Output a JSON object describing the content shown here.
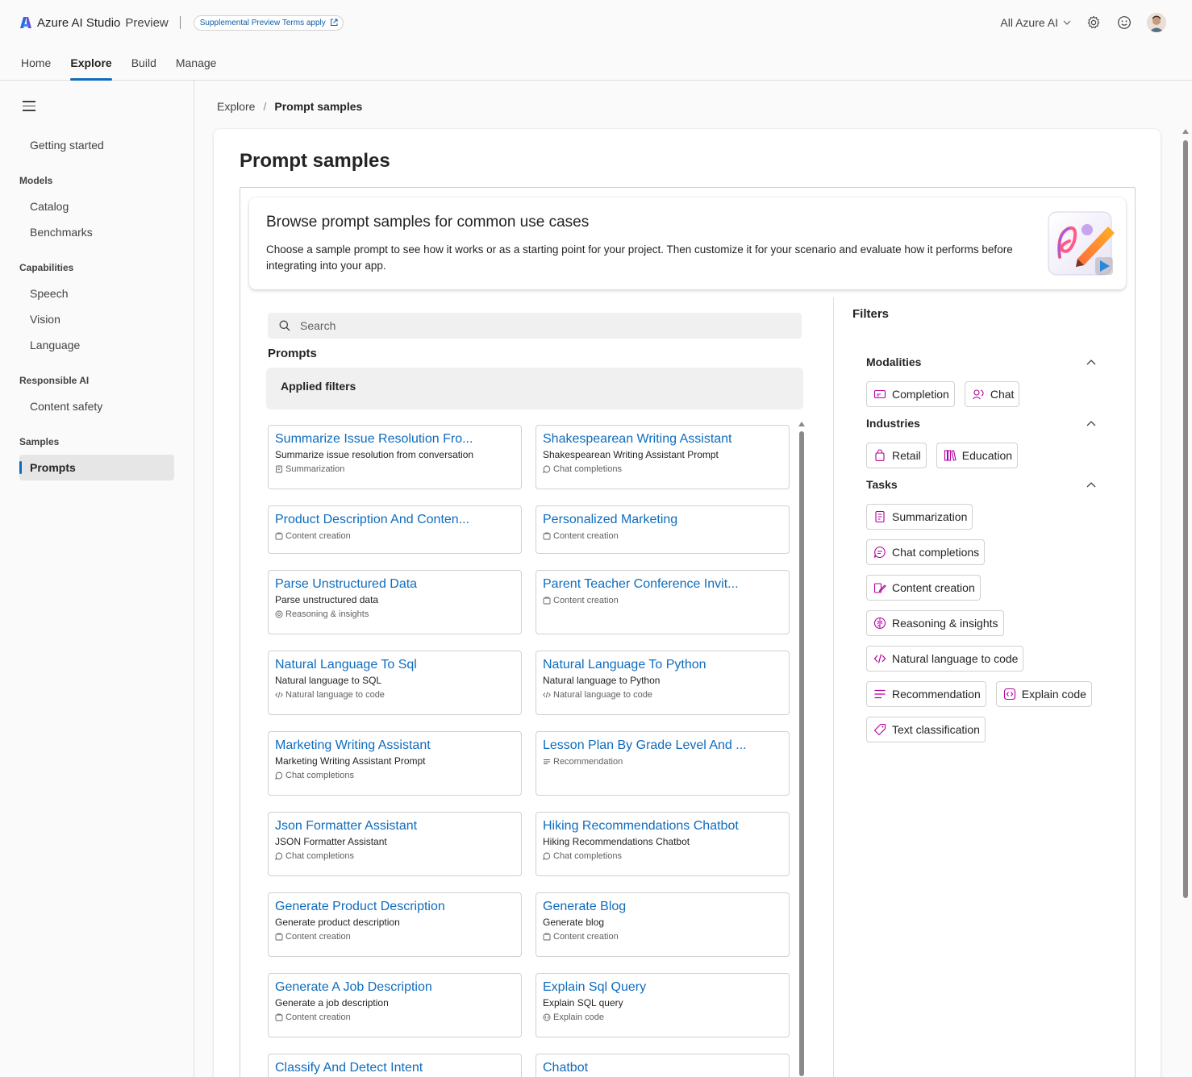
{
  "app": {
    "title": "Azure AI Studio",
    "subtitle": "Preview",
    "preview_terms": "Supplemental Preview Terms apply",
    "scope": "All Azure AI"
  },
  "nav": {
    "tabs": [
      {
        "label": "Home"
      },
      {
        "label": "Explore",
        "active": true
      },
      {
        "label": "Build"
      },
      {
        "label": "Manage"
      }
    ]
  },
  "sidebar": {
    "getting_started": "Getting started",
    "groups": [
      {
        "label": "Models",
        "items": [
          "Catalog",
          "Benchmarks"
        ]
      },
      {
        "label": "Capabilities",
        "items": [
          "Speech",
          "Vision",
          "Language"
        ]
      },
      {
        "label": "Responsible AI",
        "items": [
          "Content safety"
        ]
      },
      {
        "label": "Samples",
        "items": [
          "Prompts"
        ]
      }
    ]
  },
  "breadcrumb": {
    "parent": "Explore",
    "separator": "/",
    "current": "Prompt samples"
  },
  "page": {
    "title": "Prompt samples",
    "banner_title": "Browse prompt samples for common use cases",
    "banner_desc": "Choose a sample prompt to see how it works or as a starting point for your project. Then customize it for your scenario and evaluate how it performs before integrating into your app.",
    "search_placeholder": "Search",
    "prompts_heading": "Prompts",
    "applied_filters": "Applied filters"
  },
  "cards": [
    {
      "title": "Summarize Issue Resolution Fro...",
      "desc": "Summarize issue resolution from conversation",
      "tag": "Summarization",
      "icon": "summarization-icon"
    },
    {
      "title": "Shakespearean Writing Assistant",
      "desc": "Shakespearean Writing Assistant Prompt",
      "tag": "Chat completions",
      "icon": "chat-icon"
    },
    {
      "title": "Product Description And Conten...",
      "desc": "",
      "tag": "Content creation",
      "icon": "content-icon"
    },
    {
      "title": "Personalized Marketing",
      "desc": "",
      "tag": "Content creation",
      "icon": "content-icon"
    },
    {
      "title": "Parse Unstructured Data",
      "desc": "Parse unstructured data",
      "tag": "Reasoning & insights",
      "icon": "reasoning-icon"
    },
    {
      "title": "Parent Teacher Conference Invit...",
      "desc": "",
      "tag": "Content creation",
      "icon": "content-icon"
    },
    {
      "title": "Natural Language To Sql",
      "desc": "Natural language to SQL",
      "tag": "Natural language to code",
      "icon": "code-icon"
    },
    {
      "title": "Natural Language To Python",
      "desc": "Natural language to Python",
      "tag": "Natural language to code",
      "icon": "code-icon"
    },
    {
      "title": "Marketing Writing Assistant",
      "desc": "Marketing Writing Assistant Prompt",
      "tag": "Chat completions",
      "icon": "chat-icon"
    },
    {
      "title": "Lesson Plan By Grade Level And ...",
      "desc": "",
      "tag": "Recommendation",
      "icon": "recommendation-icon"
    },
    {
      "title": "Json Formatter Assistant",
      "desc": "JSON Formatter Assistant",
      "tag": "Chat completions",
      "icon": "chat-icon"
    },
    {
      "title": "Hiking Recommendations Chatbot",
      "desc": "Hiking Recommendations Chatbot",
      "tag": "Chat completions",
      "icon": "chat-icon"
    },
    {
      "title": "Generate Product Description",
      "desc": "Generate product description",
      "tag": "Content creation",
      "icon": "content-icon"
    },
    {
      "title": "Generate Blog",
      "desc": "Generate blog",
      "tag": "Content creation",
      "icon": "content-icon"
    },
    {
      "title": "Generate A Job Description",
      "desc": "Generate a job description",
      "tag": "Content creation",
      "icon": "content-icon"
    },
    {
      "title": "Explain Sql Query",
      "desc": "Explain SQL query",
      "tag": "Explain code",
      "icon": "explain-icon"
    },
    {
      "title": "Classify And Detect Intent",
      "desc": "",
      "tag": "",
      "icon": ""
    },
    {
      "title": "Chatbot",
      "desc": "",
      "tag": "",
      "icon": ""
    }
  ],
  "filters": {
    "title": "Filters",
    "modalities": {
      "label": "Modalities",
      "chips": [
        "Completion",
        "Chat"
      ]
    },
    "industries": {
      "label": "Industries",
      "chips": [
        "Retail",
        "Education"
      ]
    },
    "tasks": {
      "label": "Tasks",
      "chips": [
        "Summarization",
        "Chat completions",
        "Content creation",
        "Reasoning & insights",
        "Natural language to code",
        "Recommendation",
        "Explain code",
        "Text classification"
      ]
    }
  },
  "colors": {
    "accent": "#0f6cbd",
    "chip_icon": "#b4009e"
  }
}
